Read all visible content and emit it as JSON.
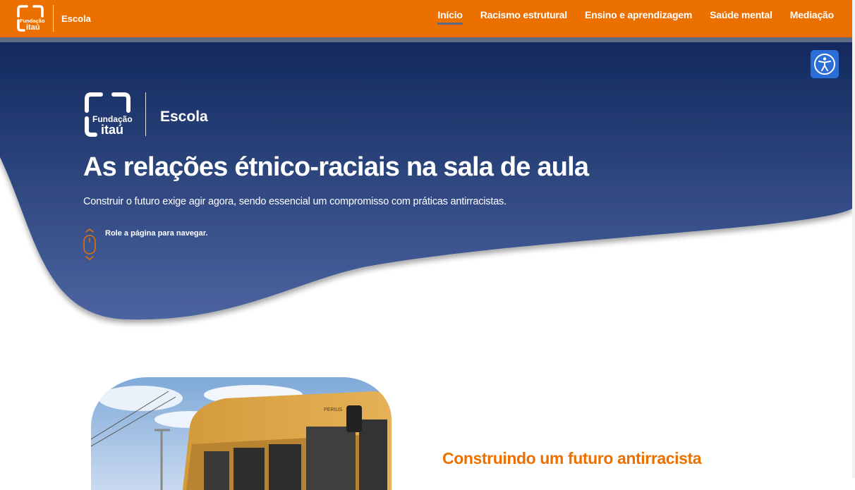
{
  "header": {
    "logo_line1": "Fundação",
    "logo_line2": "itaú",
    "brand": "Escola",
    "nav": [
      {
        "label": "Início",
        "active": true
      },
      {
        "label": "Racismo estrutural",
        "active": false
      },
      {
        "label": "Ensino e aprendizagem",
        "active": false
      },
      {
        "label": "Saúde mental",
        "active": false
      },
      {
        "label": "Mediação",
        "active": false
      }
    ]
  },
  "hero": {
    "logo_line1": "Fundação",
    "logo_line2": "itaú",
    "brand": "Escola",
    "title": "As relações étnico-raciais na sala de aula",
    "subtitle": "Construir o futuro exige agir agora, sendo essencial um compromisso com práticas antirracistas.",
    "scroll_hint": "Role a página para navegar."
  },
  "accessibility": {
    "icon": "accessibility-icon"
  },
  "section": {
    "title": "Construindo um futuro antirracista",
    "photo_icon": "school-bus-photo"
  },
  "colors": {
    "orange": "#ec7000",
    "navy_top": "#11295e",
    "navy_bottom": "#485f9a",
    "accessibility_blue": "#2b6ed8"
  }
}
